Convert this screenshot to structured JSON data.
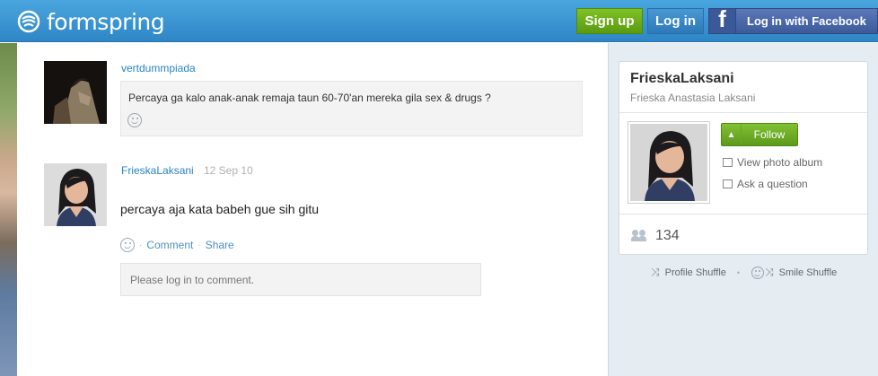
{
  "header": {
    "logo_text": "formspring",
    "signup_label": "Sign up",
    "login_label": "Log in",
    "facebook_icon_glyph": "f",
    "facebook_label": "Log in with Facebook"
  },
  "post": {
    "question": {
      "username": "vertdummpiada",
      "text": "Percaya ga kalo anak-anak remaja taun 60-70'an mereka gila sex & drugs ?"
    },
    "answer": {
      "username": "FrieskaLaksani",
      "date": "12 Sep 10",
      "text": "percaya aja kata babeh gue sih gitu"
    },
    "actions": {
      "comment_label": "Comment",
      "share_label": "Share",
      "separator": "·"
    },
    "comment_box": {
      "text": "Please log in to comment."
    }
  },
  "sidebar": {
    "profile": {
      "username": "FrieskaLaksani",
      "full_name": "Frieska Anastasia Laksani",
      "follow_label": "Follow",
      "view_album_label": "View photo album",
      "ask_question_label": "Ask a question",
      "followers_count": "134"
    },
    "shuffle": {
      "profile_shuffle_label": "Profile Shuffle",
      "smile_shuffle_label": "Smile Shuffle",
      "separator": "•"
    }
  },
  "colors": {
    "header_blue": "#2f86c6",
    "signup_green": "#6aab18",
    "facebook_blue": "#3b5998",
    "link_blue": "#2a84c4",
    "sidebar_bg": "#e5edf3"
  }
}
